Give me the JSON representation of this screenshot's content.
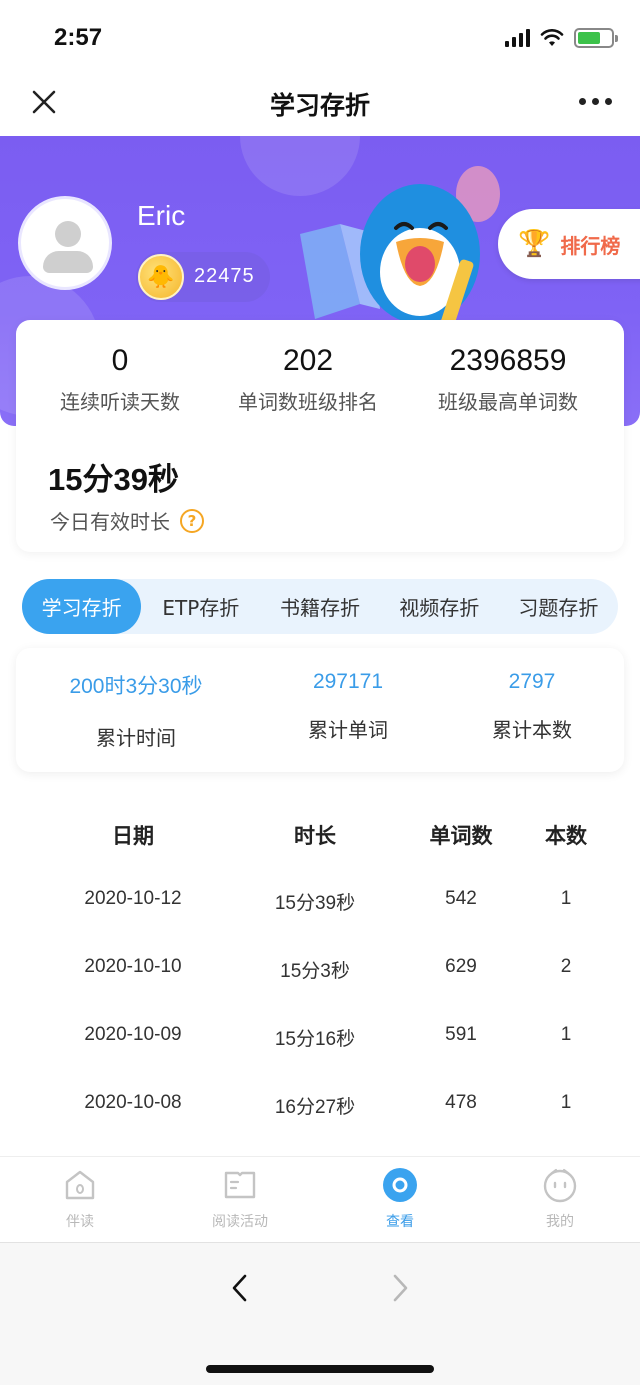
{
  "status_bar": {
    "time": "2:57",
    "icons": [
      "signal-icon",
      "wifi-icon",
      "battery-charging-icon"
    ],
    "battery_color": "#3cc24a"
  },
  "nav": {
    "title": "学习存折",
    "close_icon": "close-icon",
    "more_icon": "more-icon"
  },
  "profile": {
    "name": "Eric",
    "coins": "22475",
    "rank_button": "排行榜"
  },
  "stats": {
    "streak_value": "0",
    "streak_label": "连续听读天数",
    "rank_value": "202",
    "rank_label": "单词数班级排名",
    "max_value": "2396859",
    "max_label": "班级最高单词数",
    "today_value": "15分39秒",
    "today_label": "今日有效时长",
    "help_glyph": "?"
  },
  "tabs": [
    {
      "label": "学习存折",
      "active": true
    },
    {
      "label": "ETP存折",
      "active": false
    },
    {
      "label": "书籍存折",
      "active": false
    },
    {
      "label": "视频存折",
      "active": false
    },
    {
      "label": "习题存折",
      "active": false
    }
  ],
  "summary": {
    "time_value": "200时3分30秒",
    "time_label": "累计时间",
    "words_value": "297171",
    "words_label": "累计单词",
    "books_value": "2797",
    "books_label": "累计本数"
  },
  "table": {
    "headers": [
      "日期",
      "时长",
      "单词数",
      "本数"
    ],
    "rows": [
      [
        "2020-10-12",
        "15分39秒",
        "542",
        "1"
      ],
      [
        "2020-10-10",
        "15分3秒",
        "629",
        "2"
      ],
      [
        "2020-10-09",
        "15分16秒",
        "591",
        "1"
      ],
      [
        "2020-10-08",
        "16分27秒",
        "478",
        "1"
      ]
    ]
  },
  "tabbar": [
    {
      "label": "伴读",
      "icon": "home-icon",
      "active": false
    },
    {
      "label": "阅读活动",
      "icon": "book-icon",
      "active": false
    },
    {
      "label": "查看",
      "icon": "view-icon",
      "active": true
    },
    {
      "label": "我的",
      "icon": "profile-icon",
      "active": false
    }
  ],
  "colors": {
    "banner": "#7b5df1",
    "accent_blue": "#3aa3ef",
    "rank_text": "#f06a4a",
    "coin": "#f5b52a"
  }
}
